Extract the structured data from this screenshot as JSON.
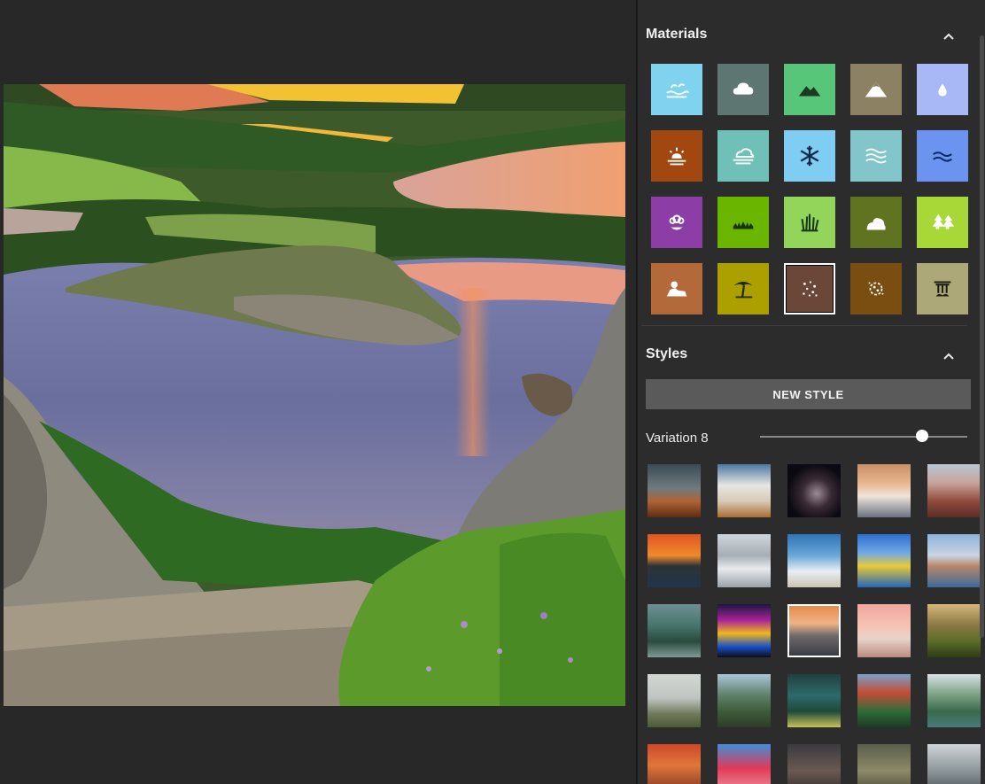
{
  "materials": {
    "title": "Materials",
    "tiles": [
      {
        "name": "sea-icon",
        "bg": "#7fd3ee",
        "selected": false
      },
      {
        "name": "cloud-icon",
        "bg": "#5e7672",
        "selected": false
      },
      {
        "name": "hill-icon",
        "bg": "#58c678",
        "selected": false
      },
      {
        "name": "mountain-icon",
        "bg": "#8d8163",
        "selected": false
      },
      {
        "name": "water-drop-icon",
        "bg": "#a8b7f5",
        "selected": false
      },
      {
        "name": "sunset-icon",
        "bg": "#a1470f",
        "selected": false
      },
      {
        "name": "fog-icon",
        "bg": "#6fc1b8",
        "selected": false
      },
      {
        "name": "snowflake-icon",
        "bg": "#7fcdf2",
        "selected": false
      },
      {
        "name": "waves-icon",
        "bg": "#82c6cc",
        "selected": false
      },
      {
        "name": "river-icon",
        "bg": "#6a94f0",
        "selected": false
      },
      {
        "name": "flower-icon",
        "bg": "#8d3ea6",
        "selected": false
      },
      {
        "name": "grass-icon",
        "bg": "#69b500",
        "selected": false
      },
      {
        "name": "tall-grass-icon",
        "bg": "#92d55a",
        "selected": false
      },
      {
        "name": "bush-icon",
        "bg": "#5f7320",
        "selected": false
      },
      {
        "name": "trees-icon",
        "bg": "#a7d837",
        "selected": false
      },
      {
        "name": "rock-icon",
        "bg": "#b3693a",
        "selected": false
      },
      {
        "name": "palm-tree-icon",
        "bg": "#aba000",
        "selected": false
      },
      {
        "name": "gravel-icon",
        "bg": "#6b4739",
        "selected": true
      },
      {
        "name": "dirt-icon",
        "bg": "#7a4e10",
        "selected": false
      },
      {
        "name": "stone-pillar-icon",
        "bg": "#aca878",
        "selected": false
      }
    ]
  },
  "styles": {
    "title": "Styles",
    "new_style_label": "NEW STYLE",
    "variation_label": "Variation 8",
    "variation_level": 0.78,
    "thumbnails": [
      {
        "name": "style-desert-dusk",
        "bg": "linear-gradient(#3c4a55 0%,#6f7b80 45%,#b16235 70%,#5d2c15 100%)",
        "selected": false
      },
      {
        "name": "style-clouds",
        "bg": "linear-gradient(#4c78a2 0%,#e6e6e3 40%,#d8c9b6 70%,#a86d34 100%)",
        "selected": false
      },
      {
        "name": "style-night-cave",
        "bg": "radial-gradient(circle at 55% 55%,#9a8b96 0%,#3a2a35 35%,#0b0a12 70%)",
        "selected": false
      },
      {
        "name": "style-misty-sunset",
        "bg": "linear-gradient(#c98f68 0%,#e8b58d 35%,#efe4da 60%,#6b7280 100%)",
        "selected": false
      },
      {
        "name": "style-red-peaks",
        "bg": "linear-gradient(#b9c7d4 0%,#c8a49a 35%,#8f4a3c 70%,#5a2e25 100%)",
        "selected": false
      },
      {
        "name": "style-ocean-sunset",
        "bg": "linear-gradient(#e05523 0%,#f08a2c 40%,#2c3338 60%,#20354a 100%)",
        "selected": false
      },
      {
        "name": "style-snowy-range",
        "bg": "linear-gradient(#cfd6dc 0%,#a6aeb5 40%,#e7ebee 65%,#9aa1a8 100%)",
        "selected": false
      },
      {
        "name": "style-sky-beach",
        "bg": "linear-gradient(#2f74b6 0%,#6aa7d8 40%,#e8eef2 70%,#c9c3b4 100%)",
        "selected": false
      },
      {
        "name": "style-flower-lake",
        "bg": "linear-gradient(#2f6fd0 0%,#6fa8e6 35%,#e8c93a 60%,#2565b8 100%)",
        "selected": false
      },
      {
        "name": "style-city-coast",
        "bg": "linear-gradient(#8fb4dc 0%,#c8d4e2 40%,#b9876a 60%,#3a6a9a 100%)",
        "selected": false
      },
      {
        "name": "style-mossy-cliffs",
        "bg": "linear-gradient(#6f8f93 0%,#47756c 40%,#2b4a3e 70%,#7e9b94 100%)",
        "selected": false
      },
      {
        "name": "style-neon-city",
        "bg": "linear-gradient(#1c1740 0%,#a8229a 30%,#f0b71e 55%,#1a4fc8 80%,#0d0c1c 100%)",
        "selected": false
      },
      {
        "name": "style-calm-sea",
        "bg": "linear-gradient(#e38a4f 0%,#f1b384 35%,#6f6a6a 60%,#3b3d44 100%)",
        "selected": true
      },
      {
        "name": "style-pastel-sky",
        "bg": "linear-gradient(#f0a6a0 0%,#f6c2b3 40%,#e8d3c8 65%,#b98b82 100%)",
        "selected": false
      },
      {
        "name": "style-green-mesa",
        "bg": "linear-gradient(#d6b77a 0%,#8a7844 40%,#5a6d26 70%,#2f3b16 100%)",
        "selected": false
      },
      {
        "name": "style-foggy-tower",
        "bg": "linear-gradient(#d3d7d4 0%,#bfc5c1 45%,#707a5a 75%,#4c5a34 100%)",
        "selected": false
      },
      {
        "name": "style-tree-rock",
        "bg": "linear-gradient(#a9c6d9 0%,#5e7f69 40%,#3f5c3a 70%,#2c3b26 100%)",
        "selected": false
      },
      {
        "name": "style-firefly-valley",
        "bg": "linear-gradient(#20403f 0%,#2e6a6a 40%,#1f4a3a 70%,#c5c25a 100%)",
        "selected": false
      },
      {
        "name": "style-pagoda",
        "bg": "linear-gradient(#7ba0c8 0%,#c24d35 35%,#2f6c3a 70%,#1d3a24 100%)",
        "selected": false
      },
      {
        "name": "style-forest-lake",
        "bg": "linear-gradient(#d8e2e6 0%,#7a9e80 40%,#3a6a4a 70%,#4a7a7a 100%)",
        "selected": false
      },
      {
        "name": "style-red-sunset",
        "bg": "linear-gradient(#d0472b 0%,#e0763a 40%,#732a1c 100%)",
        "selected": false
      },
      {
        "name": "style-fantasy-pink",
        "bg": "linear-gradient(#3e8fd8 0%,#e03a58 45%,#f0a0a8 100%)",
        "selected": false
      },
      {
        "name": "style-dark-dusk",
        "bg": "linear-gradient(#3b3a40 0%,#6a5a52 50%,#2a2426 100%)",
        "selected": false
      },
      {
        "name": "style-misty-green",
        "bg": "linear-gradient(#5a5e4a 0%,#8d8a6a 50%,#3d3f2e 100%)",
        "selected": false
      },
      {
        "name": "style-grey-cliffs",
        "bg": "linear-gradient(#cfd4d8 0%,#8d969a 50%,#3f4a4e 100%)",
        "selected": false
      }
    ]
  }
}
